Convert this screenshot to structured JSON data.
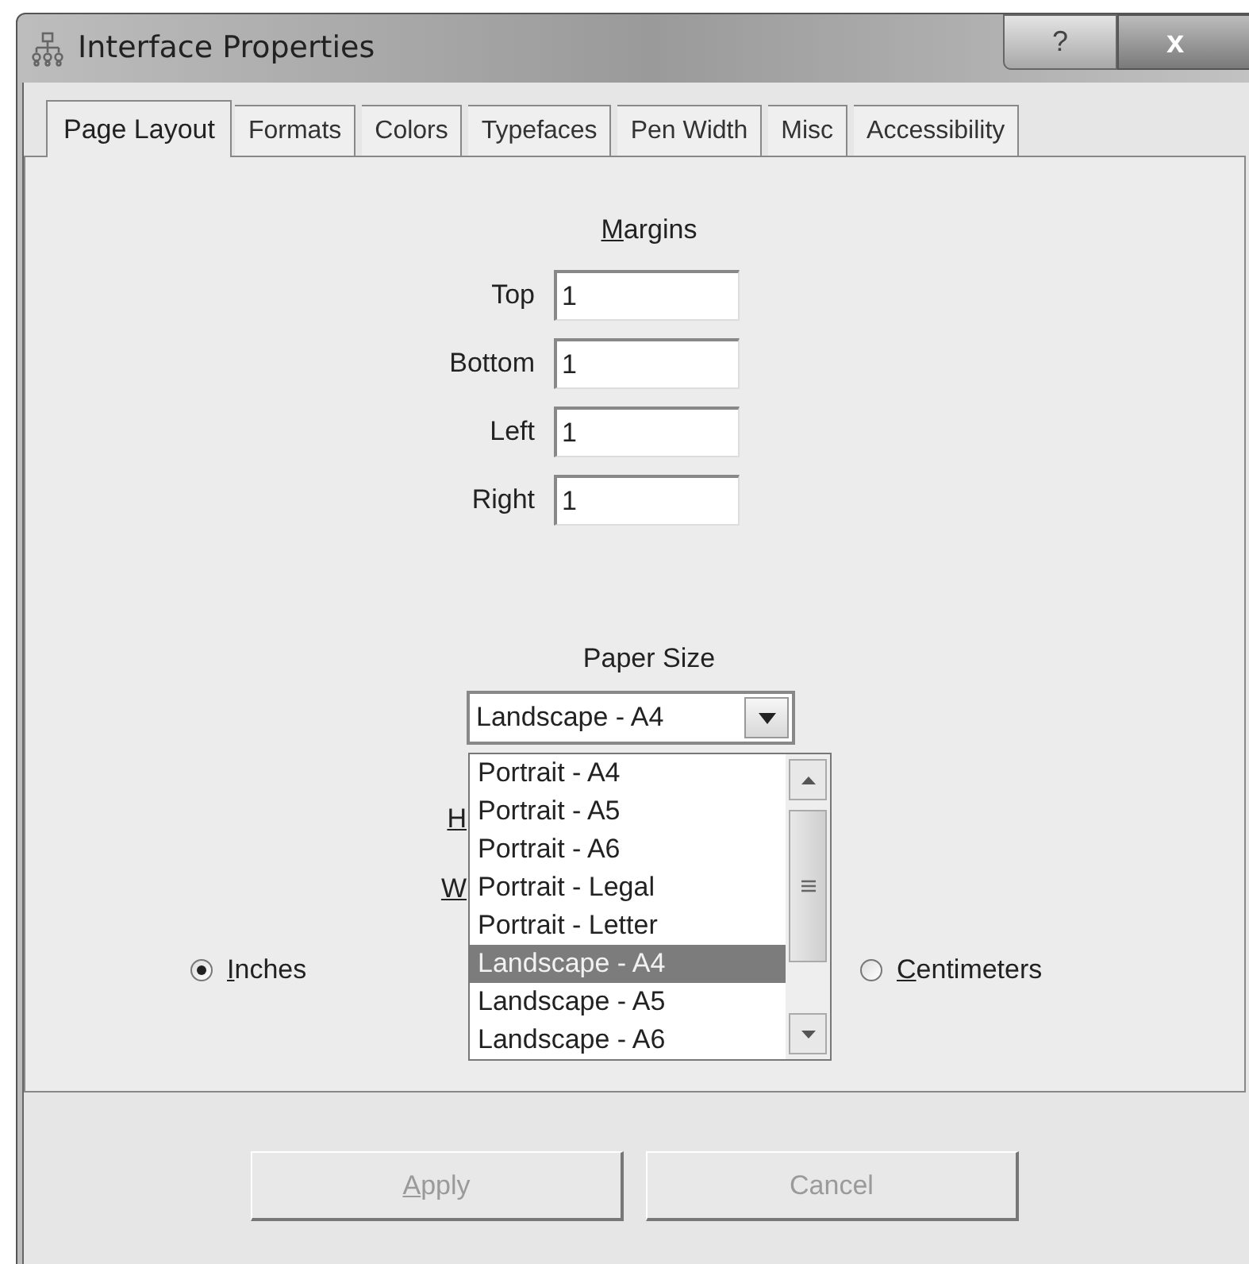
{
  "window": {
    "title": "Interface Properties",
    "help": "?",
    "close": "x"
  },
  "tabs": [
    {
      "label": "Page Layout",
      "selected": true
    },
    {
      "label": "Formats",
      "selected": false
    },
    {
      "label": "Colors",
      "selected": false
    },
    {
      "label": "Typefaces",
      "selected": false
    },
    {
      "label": "Pen Width",
      "selected": false
    },
    {
      "label": "Misc",
      "selected": false
    },
    {
      "label": "Accessibility",
      "selected": false
    }
  ],
  "margins": {
    "title": "Margins",
    "underline_first": true,
    "fields": [
      {
        "label": "Top",
        "value": "1"
      },
      {
        "label": "Bottom",
        "value": "1"
      },
      {
        "label": "Left",
        "value": "1"
      },
      {
        "label": "Right",
        "value": "1"
      }
    ]
  },
  "paper_size": {
    "title": "Paper Size",
    "value": "Landscape - A4",
    "expanded": true,
    "options": [
      {
        "label": "Portrait - A4",
        "selected": false
      },
      {
        "label": "Portrait - A5",
        "selected": false
      },
      {
        "label": "Portrait - A6",
        "selected": false
      },
      {
        "label": "Portrait - Legal",
        "selected": false
      },
      {
        "label": "Portrait - Letter",
        "selected": false
      },
      {
        "label": "Landscape - A4",
        "selected": true
      },
      {
        "label": "Landscape - A5",
        "selected": false
      },
      {
        "label": "Landscape - A6",
        "selected": false
      }
    ]
  },
  "hidden_labels": [
    {
      "text": "H",
      "underline_first": true
    },
    {
      "text": "W",
      "underline_first": true
    }
  ],
  "units": [
    {
      "label": "Inches",
      "selected": true,
      "underline_first": true
    },
    {
      "label": "Centimeters",
      "selected": false,
      "underline_first": true
    }
  ],
  "buttons": [
    {
      "label": "Apply",
      "disabled": true,
      "underline_first": true
    },
    {
      "label": "Cancel",
      "disabled": true,
      "underline_first": false
    }
  ]
}
